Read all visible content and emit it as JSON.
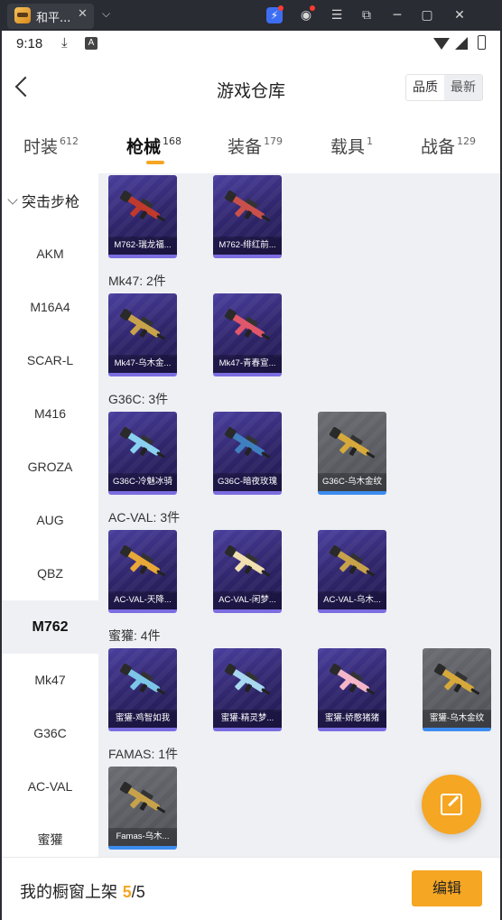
{
  "window": {
    "tab_title": "和平...",
    "tab_close": "✕",
    "tab_menu": "⌵"
  },
  "status_bar": {
    "time": "9:18"
  },
  "header": {
    "title": "游戏仓库",
    "sort_options": [
      "品质",
      "最新"
    ]
  },
  "tabs": [
    {
      "label": "时装",
      "count": "612"
    },
    {
      "label": "枪械",
      "count": "168"
    },
    {
      "label": "装备",
      "count": "179"
    },
    {
      "label": "载具",
      "count": "1"
    },
    {
      "label": "战备",
      "count": "129"
    }
  ],
  "active_tab": "枪械",
  "sidebar": {
    "category": "突击步枪",
    "items": [
      "AKM",
      "M16A4",
      "SCAR-L",
      "M416",
      "GROZA",
      "AUG",
      "QBZ",
      "M762",
      "Mk47",
      "G36C",
      "AC-VAL",
      "蜜獾"
    ],
    "active": "M762"
  },
  "groups": [
    {
      "title": "",
      "items": [
        {
          "name": "M762-瑞龙福...",
          "quality": "purple",
          "color": "#c0392b"
        },
        {
          "name": "M762-绯红前...",
          "quality": "purple",
          "color": "#c9504a"
        }
      ]
    },
    {
      "title": "Mk47: 2件",
      "items": [
        {
          "name": "Mk47-乌木金...",
          "quality": "purple",
          "color": "#c8a24a"
        },
        {
          "name": "Mk47-青春宣...",
          "quality": "purple",
          "color": "#e0566a"
        }
      ]
    },
    {
      "title": "G36C: 3件",
      "items": [
        {
          "name": "G36C-冷魅冰骑",
          "quality": "purple",
          "color": "#8ad0f0"
        },
        {
          "name": "G36C-暗夜玫瑰",
          "quality": "purple",
          "color": "#3f7fc0"
        },
        {
          "name": "G36C-乌木金纹",
          "quality": "gray",
          "color": "#d6a93a"
        }
      ]
    },
    {
      "title": "AC-VAL: 3件",
      "items": [
        {
          "name": "AC-VAL-天降...",
          "quality": "purple",
          "color": "#e8a838"
        },
        {
          "name": "AC-VAL-闲梦...",
          "quality": "purple",
          "color": "#f0e0b0"
        },
        {
          "name": "AC-VAL-乌木...",
          "quality": "purple",
          "color": "#c8a24a"
        }
      ]
    },
    {
      "title": "蜜獾: 4件",
      "items": [
        {
          "name": "蜜獾-鸡智如我",
          "quality": "purple",
          "color": "#7cc6e8"
        },
        {
          "name": "蜜獾-精灵梦...",
          "quality": "purple",
          "color": "#a8d8f0"
        },
        {
          "name": "蜜獾-娇憨猪猪",
          "quality": "purple",
          "color": "#f4b6c8"
        },
        {
          "name": "蜜獾-乌木金纹",
          "quality": "gray",
          "color": "#d6a93a"
        }
      ]
    },
    {
      "title": "FAMAS: 1件",
      "items": [
        {
          "name": "Famas-乌木...",
          "quality": "gray",
          "color": "#c8a24a"
        }
      ]
    }
  ],
  "bottom": {
    "label": "我的橱窗上架",
    "current": "5",
    "separator": "/",
    "total": "5",
    "edit_label": "编辑"
  },
  "colors": {
    "accent": "#f5a623",
    "purple_card": "#2e2468",
    "gray_card": "#56585e"
  }
}
